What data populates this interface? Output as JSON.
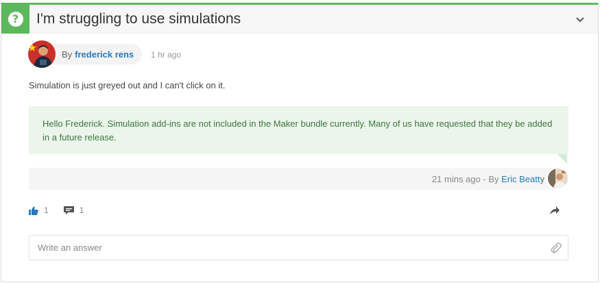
{
  "question": {
    "title": "I'm struggling to use simulations",
    "by_label": "By",
    "author": "frederick rens",
    "time": "1 hr ago",
    "body": "Simulation is just greyed out and I can't click on it."
  },
  "answer": {
    "text": "Hello Frederick. Simulation add-ins are not included in the Maker bundle currently. Many of us have requested that they be added in a future release.",
    "time": "21 mins ago",
    "separator": "-",
    "by_label": "By",
    "author": "Eric Beatty"
  },
  "actions": {
    "likes": "1",
    "comments": "1"
  },
  "reply": {
    "placeholder": "Write an answer"
  },
  "colors": {
    "accent": "#5cb85c",
    "link": "#2a7ab9",
    "answer_bg": "#ebf5eb",
    "answer_text": "#3c763d"
  },
  "icons": [
    "question-icon",
    "chevron-down-icon",
    "thumbs-up-icon",
    "comment-icon",
    "share-icon",
    "paperclip-icon"
  ]
}
